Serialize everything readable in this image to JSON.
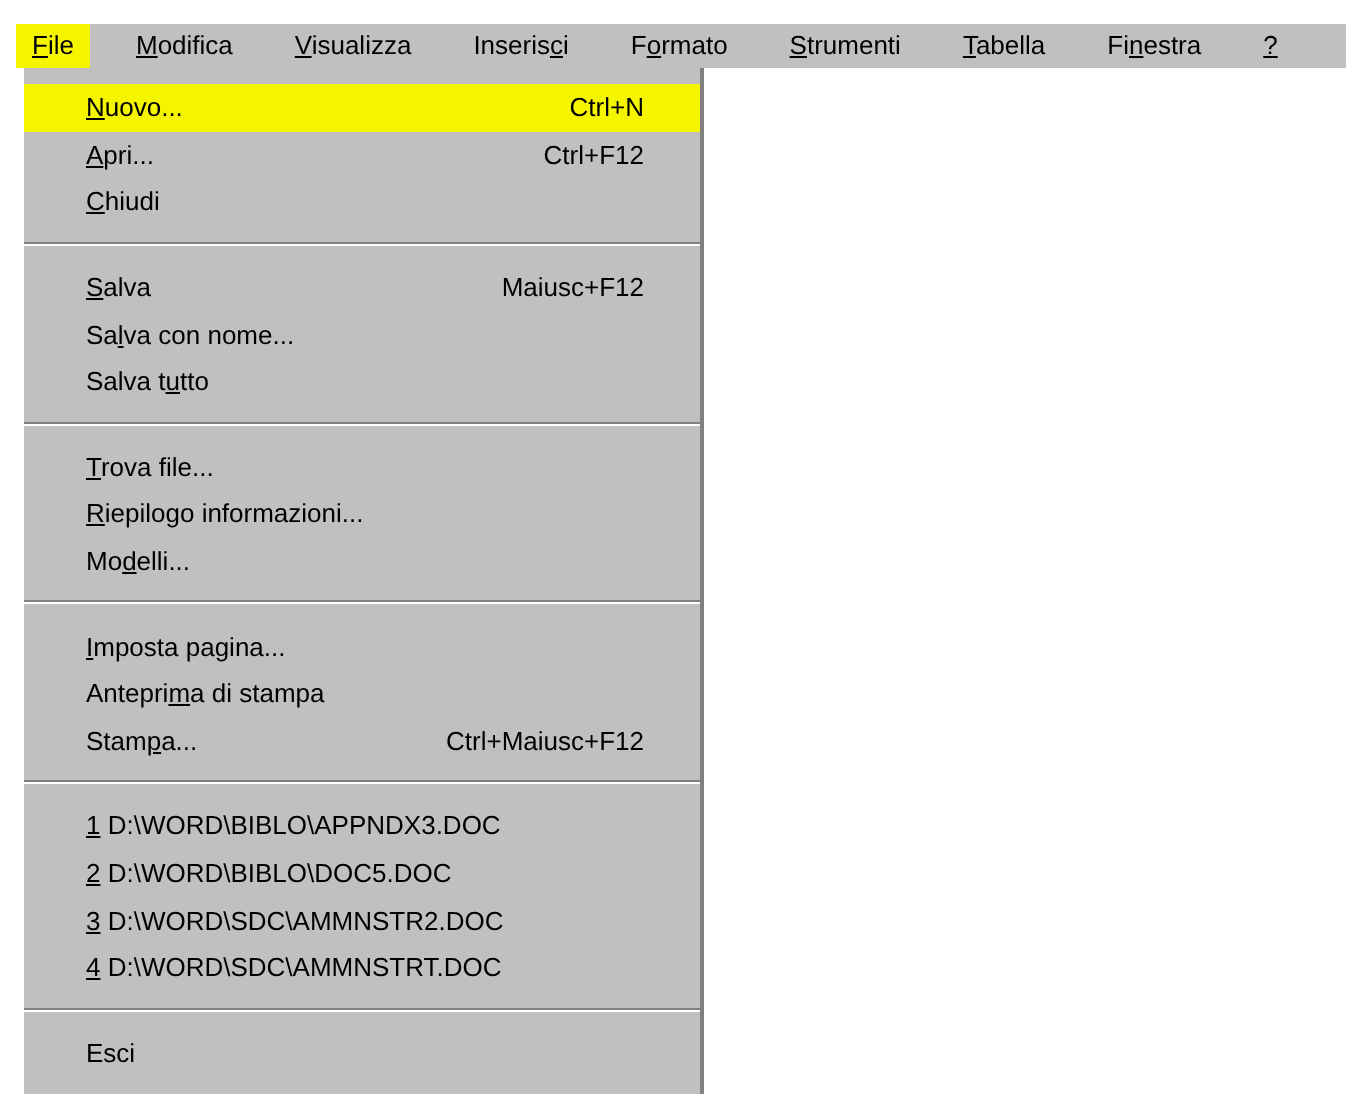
{
  "menubar": [
    {
      "label": {
        "key": "F",
        "after": "ile"
      },
      "selected": true
    },
    {
      "label": {
        "key": "M",
        "after": "odifica"
      },
      "selected": false
    },
    {
      "label": {
        "key": "V",
        "after": "isualizza"
      },
      "selected": false
    },
    {
      "label": {
        "before": "Inseris",
        "key": "c",
        "after": "i"
      },
      "selected": false
    },
    {
      "label": {
        "before": "F",
        "key": "o",
        "after": "rmato"
      },
      "selected": false
    },
    {
      "label": {
        "key": "S",
        "after": "trumenti"
      },
      "selected": false
    },
    {
      "label": {
        "key": "T",
        "after": "abella"
      },
      "selected": false
    },
    {
      "label": {
        "before": "Fi",
        "key": "n",
        "after": "estra"
      },
      "selected": false
    },
    {
      "label": {
        "key": "?"
      },
      "selected": false
    }
  ],
  "menu": {
    "groups": [
      [
        {
          "label": {
            "key": "N",
            "after": "uovo..."
          },
          "shortcut": "Ctrl+N",
          "selected": true
        },
        {
          "label": {
            "key": "A",
            "after": "pri..."
          },
          "shortcut": "Ctrl+F12",
          "selected": false
        },
        {
          "label": {
            "key": "C",
            "after": "hiudi"
          },
          "selected": false
        }
      ],
      [
        {
          "label": {
            "key": "S",
            "after": "alva"
          },
          "shortcut": "Maiusc+F12",
          "selected": false
        },
        {
          "label": {
            "before": "Sa",
            "key": "l",
            "after": "va con nome..."
          },
          "selected": false
        },
        {
          "label": {
            "before": "Salva t",
            "key": "u",
            "after": "tto"
          },
          "selected": false
        }
      ],
      [
        {
          "label": {
            "key": "T",
            "after": "rova file..."
          },
          "selected": false
        },
        {
          "label": {
            "key": "R",
            "after": "iepilogo informazioni..."
          },
          "selected": false
        },
        {
          "label": {
            "before": "Mo",
            "key": "d",
            "after": "elli..."
          },
          "selected": false
        }
      ],
      [
        {
          "label": {
            "key": "I",
            "after": "mposta pagina..."
          },
          "selected": false
        },
        {
          "label": {
            "before": "Antepri",
            "key": "m",
            "after": "a di stampa"
          },
          "selected": false
        },
        {
          "label": {
            "before": "Stam",
            "key": "p",
            "after": "a..."
          },
          "shortcut": "Ctrl+Maiusc+F12",
          "selected": false
        }
      ],
      [
        {
          "label": {
            "key": "1",
            "after": " D:\\WORD\\BIBLO\\APPNDX3.DOC"
          },
          "selected": false
        },
        {
          "label": {
            "key": "2",
            "after": " D:\\WORD\\BIBLO\\DOC5.DOC"
          },
          "selected": false
        },
        {
          "label": {
            "key": "3",
            "after": " D:\\WORD\\SDC\\AMMNSTR2.DOC"
          },
          "selected": false
        },
        {
          "label": {
            "key": "4",
            "after": " D:\\WORD\\SDC\\AMMNSTRT.DOC"
          },
          "selected": false
        }
      ],
      [
        {
          "label": {
            "before": "Esci"
          },
          "selected": false
        }
      ]
    ]
  }
}
